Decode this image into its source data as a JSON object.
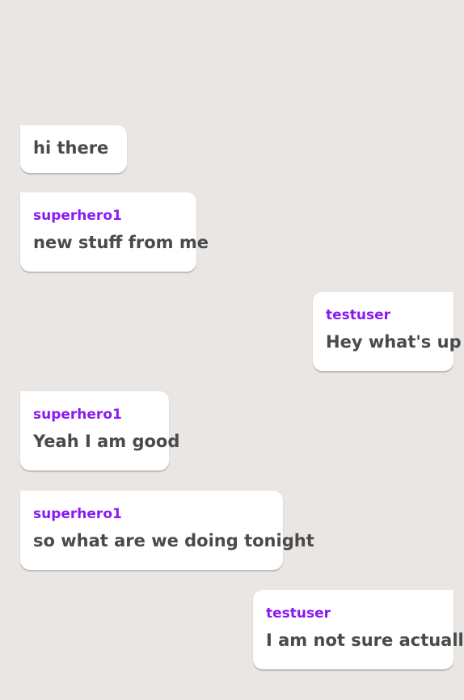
{
  "colors": {
    "background": "#e9e6e4",
    "bubble": "#ffffff",
    "sender": "#8a19f2",
    "text": "#4a4a4a"
  },
  "messages": [
    {
      "sender": "",
      "text": "hi there",
      "side": "left"
    },
    {
      "sender": "superhero1",
      "text": "new stuff from me",
      "side": "left"
    },
    {
      "sender": "testuser",
      "text": "Hey what's up",
      "side": "right"
    },
    {
      "sender": "superhero1",
      "text": "Yeah I am good",
      "side": "left"
    },
    {
      "sender": "superhero1",
      "text": "so what are we doing tonight",
      "side": "left"
    },
    {
      "sender": "testuser",
      "text": "I am not sure actually",
      "side": "right"
    }
  ]
}
